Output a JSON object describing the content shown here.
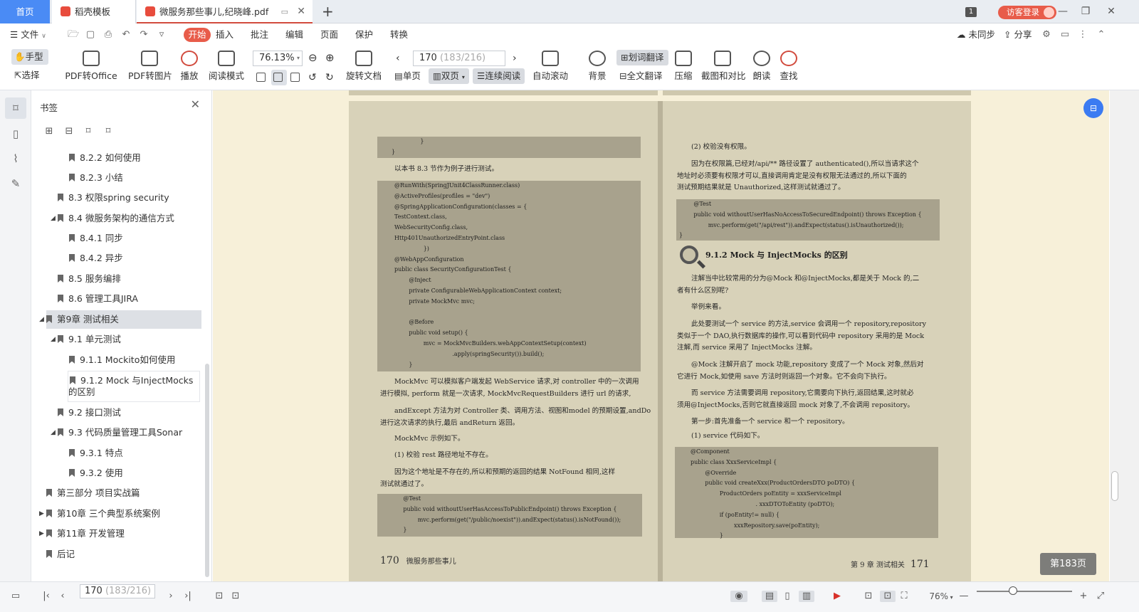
{
  "tabs": {
    "home": "首页",
    "template": "稻壳模板",
    "pdf": "微服务那些事儿,纪晓峰.pdf"
  },
  "titlebar": {
    "counter": "1",
    "login": "访客登录"
  },
  "menu": {
    "file": "文件",
    "items": [
      "开始",
      "插入",
      "批注",
      "编辑",
      "页面",
      "保护",
      "转换"
    ],
    "sync": "未同步",
    "share": "分享"
  },
  "toolbar": {
    "hand": "手型",
    "select": "选择",
    "pdf_to_office": "PDF转Office",
    "pdf_to_image": "PDF转图片",
    "play": "播放",
    "read_mode": "阅读模式",
    "zoom": "76.13%",
    "rotate": "旋转文档",
    "page_current": "170",
    "page_total": "(183/216)",
    "single": "单页",
    "double": "双页",
    "continuous": "连续阅读",
    "auto_scroll": "自动滚动",
    "background": "背景",
    "word_translate": "划词翻译",
    "full_translate": "全文翻译",
    "compress": "压缩",
    "screenshot_compare": "截图和对比",
    "read_aloud": "朗读",
    "find": "查找"
  },
  "sidebar": {
    "title": "书签",
    "bookmarks": [
      {
        "label": "8.2.2 如何使用"
      },
      {
        "label": "8.2.3 小结"
      },
      {
        "label": "8.3 权限spring security"
      },
      {
        "label": "8.4 微服务架构的通信方式"
      },
      {
        "label": "8.4.1 同步"
      },
      {
        "label": "8.4.2 异步"
      },
      {
        "label": "8.5 服务编排"
      },
      {
        "label": "8.6 管理工具JIRA"
      },
      {
        "label": "第9章 测试相关"
      },
      {
        "label": "9.1 单元测试"
      },
      {
        "label": "9.1.1 Mockito如何使用"
      },
      {
        "label": "9.1.2 Mock 与InjectMocks的区别"
      },
      {
        "label": "9.2 接口测试"
      },
      {
        "label": "9.3 代码质量管理工具Sonar"
      },
      {
        "label": "9.3.1 特点"
      },
      {
        "label": "9.3.2 使用"
      },
      {
        "label": "第三部分 项目实战篇"
      },
      {
        "label": "第10章 三个典型系统案例"
      },
      {
        "label": "第11章 开发管理"
      },
      {
        "label": "后记"
      }
    ]
  },
  "left_page": {
    "code1": [
      "        }",
      "}"
    ],
    "intro": "以本书 8.3 节作为例子进行测试。",
    "code2": [
      "@RunWith(SpringJUnit4ClassRunner.class)",
      "@ActiveProfiles(profiles = \"dev\")",
      "@SpringApplicationConfiguration(classes = {",
      "TestContext.class,",
      "WebSecurityConfig.class,",
      "Http401UnauthorizedEntryPoint.class",
      "                })",
      "@WebAppConfiguration",
      "public class SecurityConfigurationTest {",
      "        @Inject",
      "        private ConfigurableWebApplicationContext context;",
      "        private MockMvc mvc;",
      "",
      "        @Before",
      "        public void setup() {",
      "                mvc = MockMvcBuilders.webAppContextSetup(context)",
      "                                .apply(springSecurity()).build();",
      "        }"
    ],
    "para1": [
      "MockMvc 可以模拟客户端发起 WebService 请求,对 controller 中的一次调用",
      "进行模拟, perform 就是一次请求, MockMvcRequestBuilders 进行 url 的请求,"
    ],
    "para2": [
      "andExcept 方法为对 Controller 类、调用方法、视图和model 的预期设置,andDo",
      "进行这次请求的执行,最后 andReturn 返回。"
    ],
    "para3": "MockMvc 示例如下。",
    "para4": "(1) 校验 rest 路径地址不存在。",
    "para5": [
      "因为这个地址是不存在的,所以和预期的返回的结果 NotFound 相同,这样",
      "测试就通过了。"
    ],
    "code3": [
      "        @Test",
      "        public void withoutUserHasAccessToPublicEndpoint() throws Exception {",
      "                mvc.perform(get(\"/public/noexist\")).andExpect(status().isNotFound());",
      "        }"
    ],
    "folio_num": "170",
    "folio_title": "微服务那些事儿"
  },
  "right_page": {
    "p1": "(2) 校验没有权限。",
    "p2": [
      "因为在权限篇,已经对/api/** 路径设置了 authenticated(),所以当请求这个",
      "地址时必须要有权限才可以,直接调用肯定是没有权限无法通过的,所以下面的",
      "测试预期结果就是 Unauthorized,这样测试就通过了。"
    ],
    "code1": [
      "        @Test",
      "        public void withoutUserHasNoAccessToSecuredEndpoint() throws Exception {",
      "                mvc.perform(get(\"/api/rest\")).andExpect(status().isUnauthorized());",
      "}"
    ],
    "heading": "9.1.2   Mock 与 InjectMocks 的区别",
    "p3": [
      "注解当中比较常用的分为@Mock 和@InjectMocks,都是关于 Mock 的,二",
      "者有什么区别呢?"
    ],
    "p4": "举例来看。",
    "p5": [
      "此处要测试一个 service 的方法,service 会调用一个 repository,repository",
      "类似于一个 DAO,执行数据库的操作,可以看到代码中 repository 采用的是 Mock",
      "注解,而 service 采用了 InjectMocks 注解。"
    ],
    "p6": [
      "@Mock 注解开启了 mock 功能,repository 变成了一个 Mock 对象,然后对",
      "它进行 Mock,如使用 save 方法时则返回一个对象。它不会向下执行。"
    ],
    "p7": [
      "而 service 方法需要调用 repository,它需要向下执行,返回结果,这时就必",
      "须用@InjectMocks,否则它就直接返回 mock 对象了,不会调用 repository。"
    ],
    "p8": "第一步:首先准备一个 service 和一个 repository。",
    "p9": "(1) service 代码如下。",
    "code2": [
      "@Component",
      "public class XxxServiceImpl {",
      "        @Override",
      "        public void createXxx(ProductOrdersDTO poDTO) {",
      "                ProductOrders poEntity = xxxServiceImpl",
      "                                    . xxxDTOToEntity (poDTO);",
      "                if (poEntity!= null) {",
      "                        xxxRepository.save(poEntity);",
      "                }"
    ],
    "folio_chapter": "第 9 章   测试相关",
    "folio_num": "171"
  },
  "page_badge": "第183页",
  "status": {
    "page_current": "170",
    "page_total": "(183/216)",
    "zoom": "76%"
  }
}
